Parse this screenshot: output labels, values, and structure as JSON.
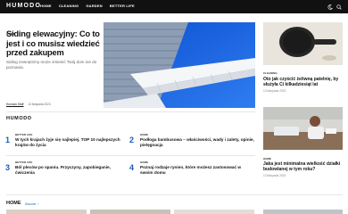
{
  "brand": {
    "logo": "HUMODO"
  },
  "nav": {
    "items": [
      {
        "label": "HOME"
      },
      {
        "label": "CLEANING"
      },
      {
        "label": "GARDEN"
      },
      {
        "label": "BETTER LIFE"
      }
    ],
    "icons": [
      "moon-icon",
      "search-icon"
    ]
  },
  "hero": {
    "tag": "HOME",
    "title": "Siding elewacyjny: Co to jest i co musisz wiedzieć przed zakupem",
    "excerpt": "Siding zewnętrzny może zmienić Twój dom nie do poznania.",
    "author": "Humodo Staff",
    "date": "13 listopada 2023"
  },
  "side_cards": [
    {
      "tag": "CLEANING",
      "title": "Oto jak czyścić żeliwną patelnię, by służyła Ci kilkadziesiąt lat",
      "date": "13 listopada 2023"
    },
    {
      "tag": "HOME",
      "title": "Jaka jest minimalna wielkość działki budowlanej w tym roku?",
      "date": "13 listopada 2023"
    }
  ],
  "featured": {
    "section_title": "HUMODO",
    "items": [
      {
        "num": "1",
        "tag": "BETTER LIFE",
        "title": "W tych krajach żyje się najlepiej. TOP 10 najlepszych krajów do życia"
      },
      {
        "num": "2",
        "tag": "HOME",
        "title": "Podłoga bambusowa – właściwości, wady i zalety, opinie, pielęgnacja"
      },
      {
        "num": "3",
        "tag": "BETTER LIFE",
        "title": "Ból pleców po spaniu. Przyczyny, zapobieganie, ćwiczenia"
      },
      {
        "num": "4",
        "tag": "HOME",
        "title": "Poznaj rodzaje rynien, które możesz zastosować w swoim domu"
      }
    ]
  },
  "home_section": {
    "title": "HOME",
    "link": "Discover"
  },
  "colors": {
    "topbar": "#111111",
    "accent": "#1f5bb8",
    "text": "#111111",
    "muted": "#666666"
  }
}
